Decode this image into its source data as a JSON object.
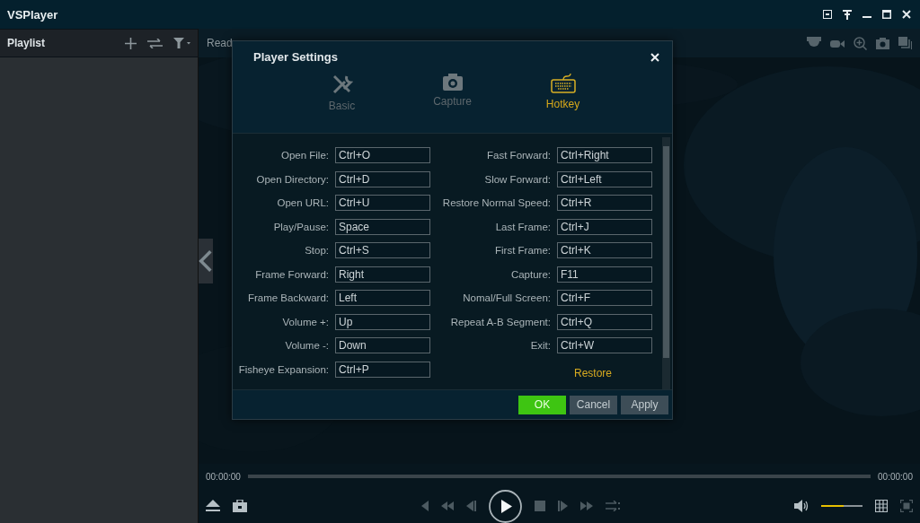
{
  "window": {
    "title": "VSPlayer"
  },
  "playlist": {
    "title": "Playlist"
  },
  "toolbar": {
    "status": "Read"
  },
  "dialog": {
    "title": "Player Settings",
    "tabs": [
      {
        "label": "Basic",
        "kind": "tools",
        "selected": false
      },
      {
        "label": "Capture",
        "kind": "camera",
        "selected": false
      },
      {
        "label": "Hotkey",
        "kind": "keyboard",
        "selected": true
      }
    ],
    "hotkeys_left": [
      {
        "label": "Open File:",
        "value": "Ctrl+O"
      },
      {
        "label": "Open Directory:",
        "value": "Ctrl+D"
      },
      {
        "label": "Open URL:",
        "value": "Ctrl+U"
      },
      {
        "label": "Play/Pause:",
        "value": "Space"
      },
      {
        "label": "Stop:",
        "value": "Ctrl+S"
      },
      {
        "label": "Frame Forward:",
        "value": "Right"
      },
      {
        "label": "Frame Backward:",
        "value": "Left"
      },
      {
        "label": "Volume +:",
        "value": "Up"
      },
      {
        "label": "Volume -:",
        "value": "Down"
      },
      {
        "label": "Fisheye Expansion:",
        "value": "Ctrl+P"
      }
    ],
    "hotkeys_right": [
      {
        "label": "Fast Forward:",
        "value": "Ctrl+Right"
      },
      {
        "label": "Slow Forward:",
        "value": "Ctrl+Left"
      },
      {
        "label": "Restore Normal Speed:",
        "value": "Ctrl+R"
      },
      {
        "label": "Last Frame:",
        "value": "Ctrl+J"
      },
      {
        "label": "First Frame:",
        "value": "Ctrl+K"
      },
      {
        "label": "Capture:",
        "value": "F11"
      },
      {
        "label": "Nomal/Full Screen:",
        "value": "Ctrl+F"
      },
      {
        "label": "Repeat A-B Segment:",
        "value": "Ctrl+Q"
      },
      {
        "label": "Exit:",
        "value": "Ctrl+W"
      }
    ],
    "restore": "Restore",
    "buttons": [
      {
        "label": "OK",
        "kind": "primary"
      },
      {
        "label": "Cancel",
        "kind": "secondary"
      },
      {
        "label": "Apply",
        "kind": "secondary"
      }
    ]
  },
  "playback": {
    "elapsed": "00:00:00",
    "total": "00:00:00",
    "progress": {
      "level": 0
    },
    "volume": {
      "level": 0.55
    }
  }
}
